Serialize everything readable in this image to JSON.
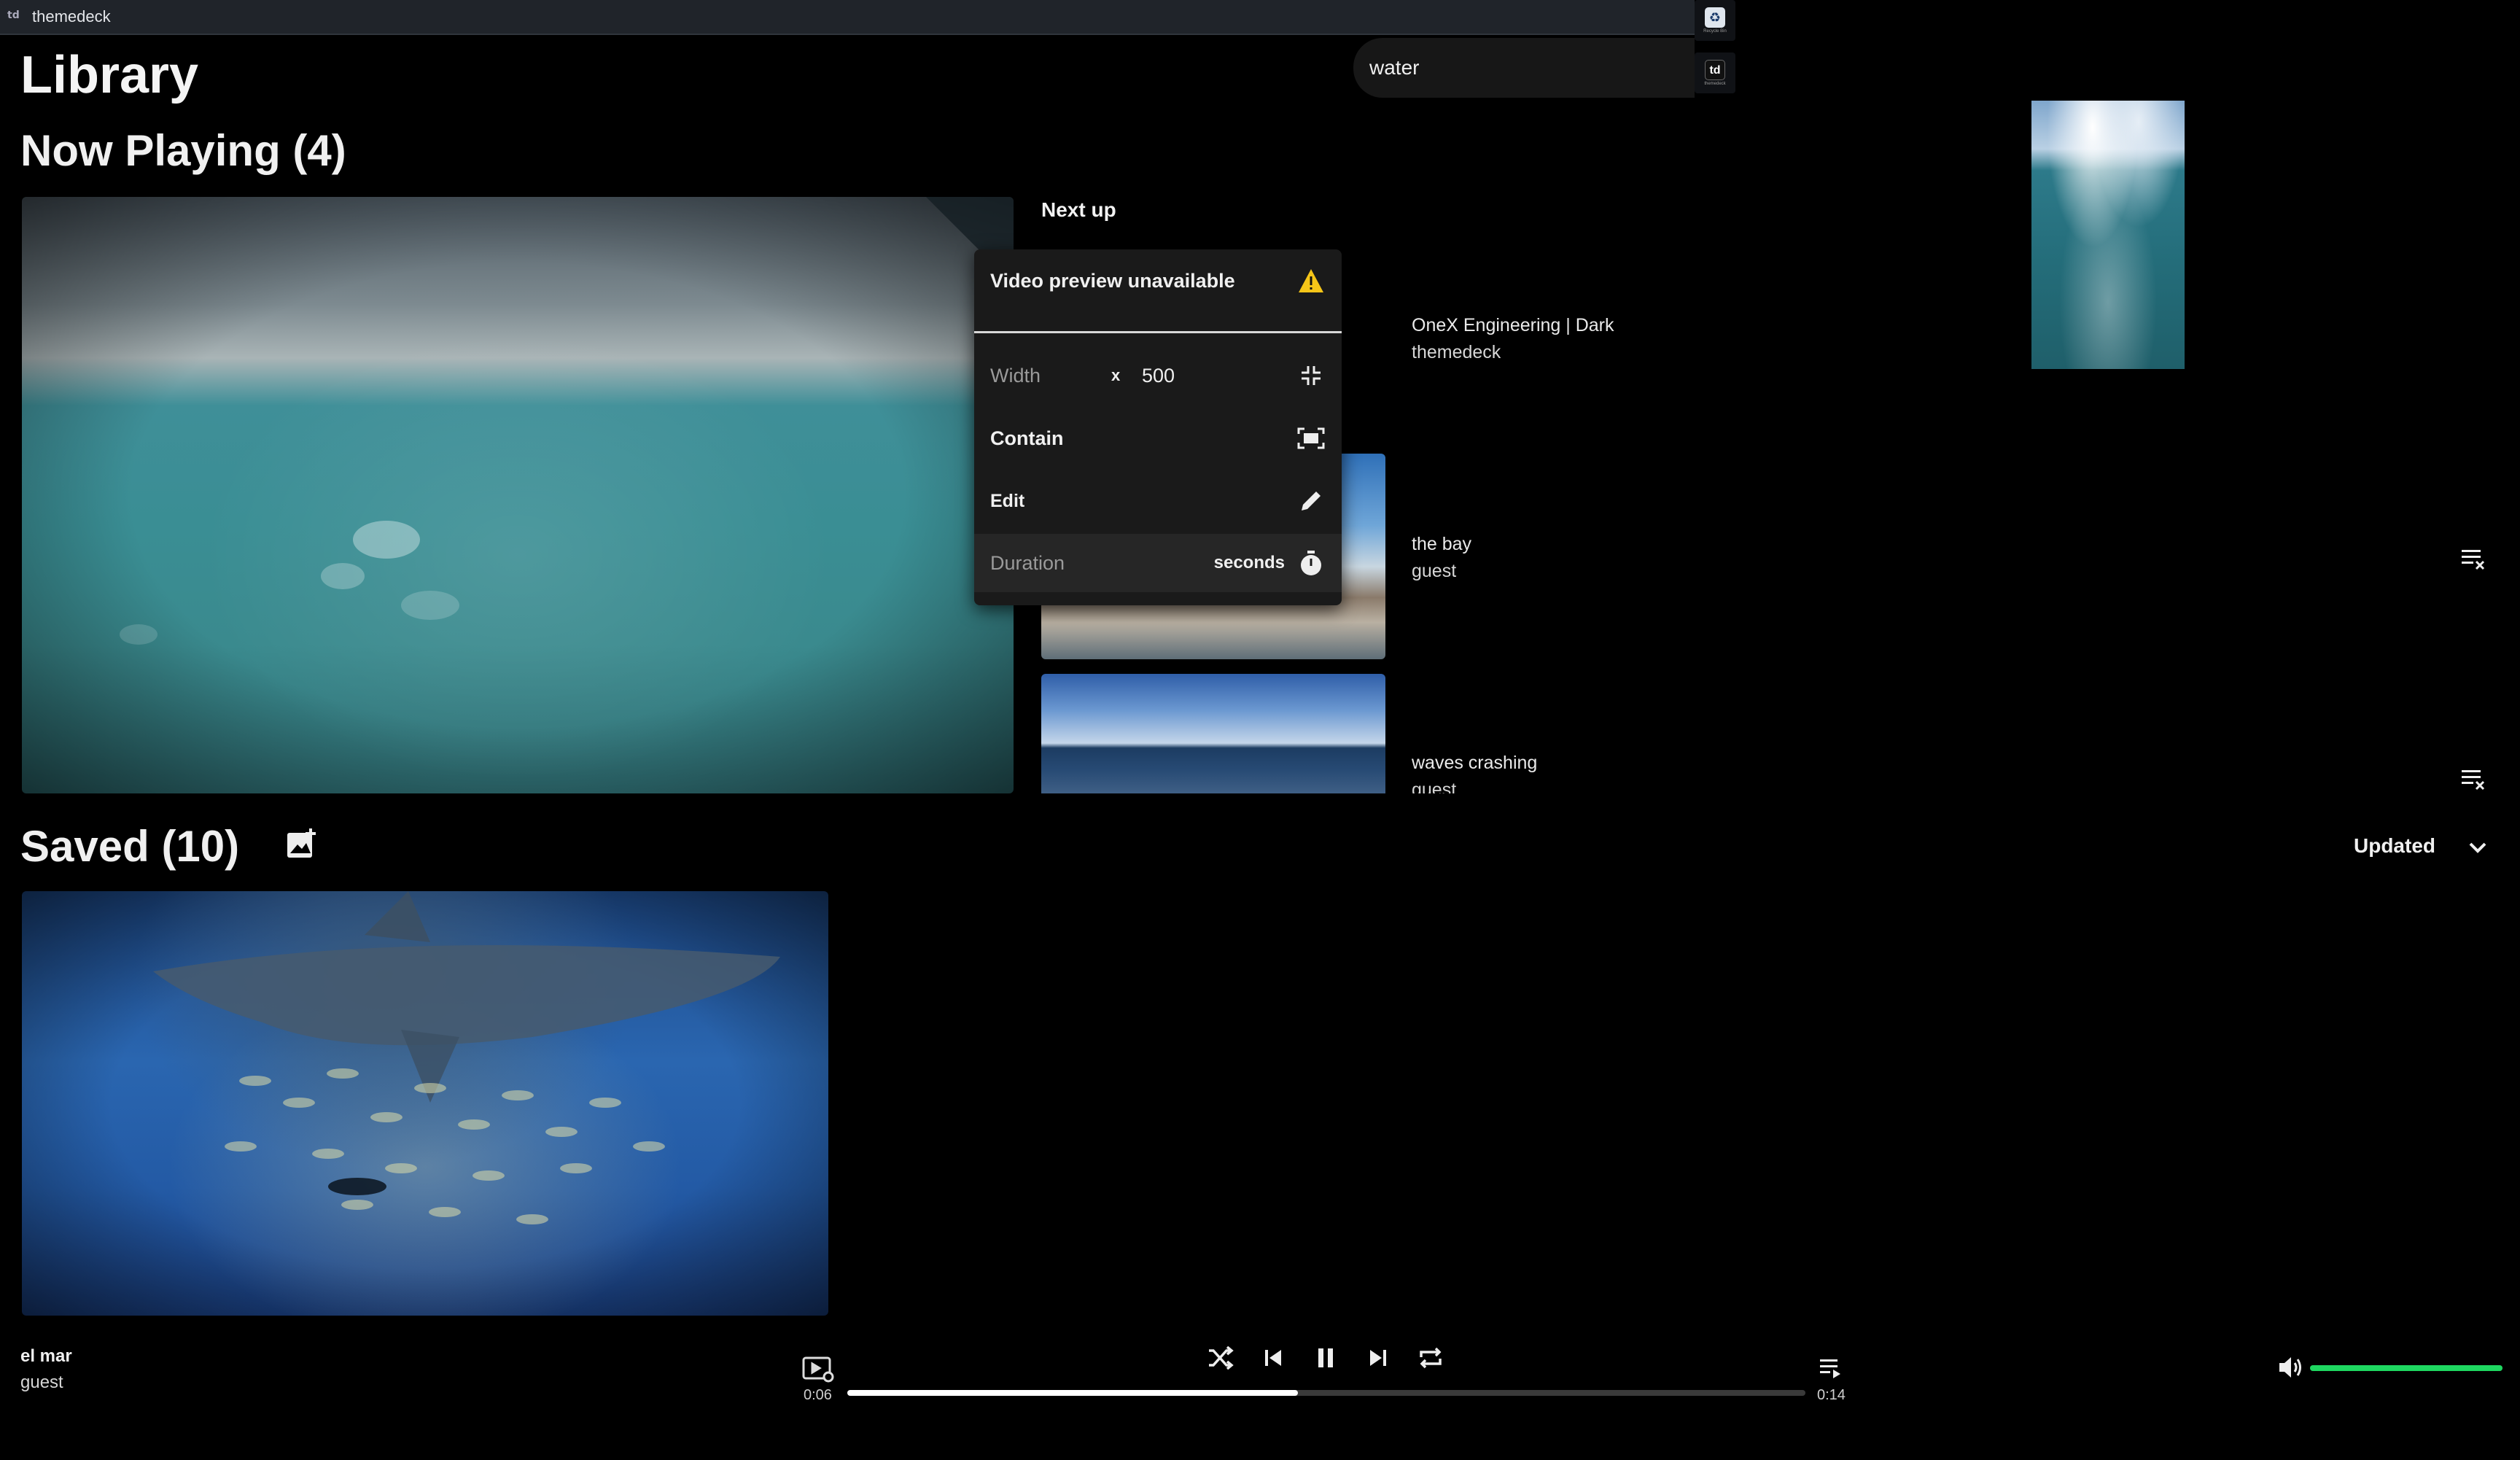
{
  "window": {
    "title": "themedeck",
    "app_icon_text": "td"
  },
  "desktop_icons": [
    {
      "name": "recycle-bin",
      "label": "Recycle Bin",
      "glyph": "♻"
    },
    {
      "name": "themedeck",
      "label": "themedeck",
      "glyph": "td"
    }
  ],
  "header": {
    "title": "Library"
  },
  "search": {
    "value": "water"
  },
  "now_playing": {
    "heading": "Now Playing (4)",
    "next_up_label": "Next up",
    "queue": [
      {
        "title": "OneX Engineering | Dark",
        "subtitle": "themedeck"
      },
      {
        "title": "the bay",
        "subtitle": "guest"
      },
      {
        "title": "waves crashing",
        "subtitle": "guest"
      }
    ]
  },
  "context_menu": {
    "header": "Video preview unavailable",
    "width_label": "Width",
    "times_symbol": "x",
    "width_value": "500",
    "contain_label": "Contain",
    "edit_label": "Edit",
    "duration_placeholder": "Duration",
    "duration_unit": "seconds"
  },
  "saved": {
    "heading": "Saved (10)",
    "sort_label": "Updated"
  },
  "player": {
    "track_title": "el mar",
    "track_artist": "guest",
    "elapsed": "0:06",
    "total": "0:14",
    "progress_fraction": 0.47,
    "volume_fraction": 1.0
  },
  "colors": {
    "accent": "#1ed760",
    "warning": "#f5c518",
    "background": "#000000",
    "menu_bg": "#1a1a1a"
  }
}
